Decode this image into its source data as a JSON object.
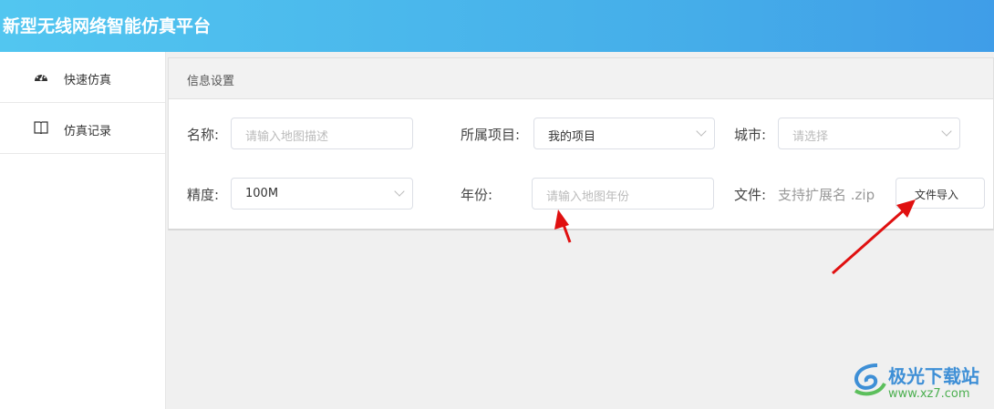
{
  "header": {
    "title": "新型无线网络智能仿真平台"
  },
  "sidebar": {
    "items": [
      {
        "label": "快速仿真",
        "icon": "dashboard-icon"
      },
      {
        "label": "仿真记录",
        "icon": "book-icon"
      }
    ]
  },
  "card": {
    "title": "信息设置",
    "name": {
      "label": "名称:",
      "placeholder": "请输入地图描述"
    },
    "project": {
      "label": "所属项目:",
      "value": "我的项目"
    },
    "city": {
      "label": "城市:",
      "placeholder": "请选择"
    },
    "precision": {
      "label": "精度:",
      "value": "100M"
    },
    "year": {
      "label": "年份:",
      "placeholder": "请输入地图年份"
    },
    "file": {
      "label": "文件:",
      "hint": "支持扩展名 .zip",
      "button": "文件导入"
    }
  },
  "watermark": {
    "name": "极光下载站",
    "url": "www.xz7.com"
  },
  "colors": {
    "arrow": "#e01010",
    "header": "#4ab8ee"
  }
}
